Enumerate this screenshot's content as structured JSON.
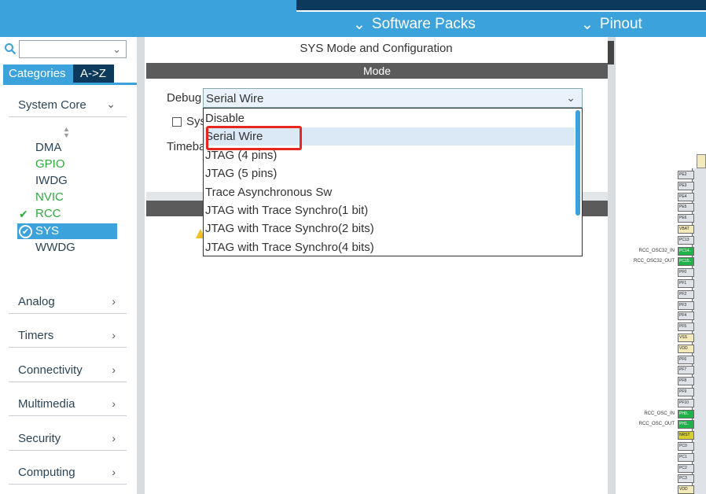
{
  "header": {
    "software_packs": "Software Packs",
    "pinout": "Pinout"
  },
  "left_panel": {
    "tabs": [
      "Categories",
      "A->Z"
    ],
    "categories": [
      {
        "label": "System Core",
        "expanded": true
      },
      {
        "label": "Analog"
      },
      {
        "label": "Timers"
      },
      {
        "label": "Connectivity"
      },
      {
        "label": "Multimedia"
      },
      {
        "label": "Security"
      },
      {
        "label": "Computing"
      }
    ],
    "system_core_items": [
      {
        "label": "DMA",
        "status": "normal"
      },
      {
        "label": "GPIO",
        "status": "green"
      },
      {
        "label": "IWDG",
        "status": "normal"
      },
      {
        "label": "NVIC",
        "status": "green"
      },
      {
        "label": "RCC",
        "status": "checked"
      },
      {
        "label": "SYS",
        "status": "selected"
      },
      {
        "label": "WWDG",
        "status": "normal"
      }
    ]
  },
  "config": {
    "title": "SYS Mode and Configuration",
    "mode_header": "Mode",
    "debug_label": "Debug",
    "debug_value": "Serial Wire",
    "sys_label": "Sys",
    "timebase_label": "Timeba",
    "dropdown_options": [
      "Disable",
      "Serial Wire",
      "JTAG (4 pins)",
      "JTAG (5 pins)",
      "Trace Asynchronous Sw",
      "JTAG with Trace Synchro(1 bit)",
      "JTAG with Trace Synchro(2 bits)",
      "JTAG with Trace Synchro(4 bits)"
    ],
    "selected_index": 1
  },
  "pinout": {
    "pins": [
      {
        "name": "PE2",
        "color": "gray"
      },
      {
        "name": "PE3",
        "color": "gray"
      },
      {
        "name": "PE4",
        "color": "gray"
      },
      {
        "name": "PE5",
        "color": "gray"
      },
      {
        "name": "PE6",
        "color": "gray"
      },
      {
        "name": "VBAT",
        "color": "yellow"
      },
      {
        "name": "PC13",
        "color": "gray"
      },
      {
        "name": "PC14..",
        "color": "green",
        "signal": "RCC_OSC32_IN"
      },
      {
        "name": "PC15..",
        "color": "green",
        "signal": "RCC_OSC32_OUT"
      },
      {
        "name": "PF0",
        "color": "gray"
      },
      {
        "name": "PF1",
        "color": "gray"
      },
      {
        "name": "PF2",
        "color": "gray"
      },
      {
        "name": "PF3",
        "color": "gray"
      },
      {
        "name": "PF4",
        "color": "gray"
      },
      {
        "name": "PF5",
        "color": "gray"
      },
      {
        "name": "VSS",
        "color": "yellow"
      },
      {
        "name": "VDD",
        "color": "yellow"
      },
      {
        "name": "PF6",
        "color": "gray"
      },
      {
        "name": "PF7",
        "color": "gray"
      },
      {
        "name": "PF8",
        "color": "gray"
      },
      {
        "name": "PF9",
        "color": "gray"
      },
      {
        "name": "PF10",
        "color": "gray"
      },
      {
        "name": "PH0..",
        "color": "green",
        "signal": "RCC_OSC_IN"
      },
      {
        "name": "PH1..",
        "color": "green",
        "signal": "RCC_OSC_OUT"
      },
      {
        "name": "NRST",
        "color": "olive"
      },
      {
        "name": "PC0",
        "color": "gray"
      },
      {
        "name": "PC1",
        "color": "gray"
      },
      {
        "name": "PC2",
        "color": "gray"
      },
      {
        "name": "PC3",
        "color": "gray"
      },
      {
        "name": "VDD",
        "color": "yellow"
      }
    ]
  },
  "colors": {
    "accent": "#3ca2dc",
    "dark": "#0d3a5c",
    "highlight": "#e8261e",
    "green": "#2eaa3d"
  }
}
